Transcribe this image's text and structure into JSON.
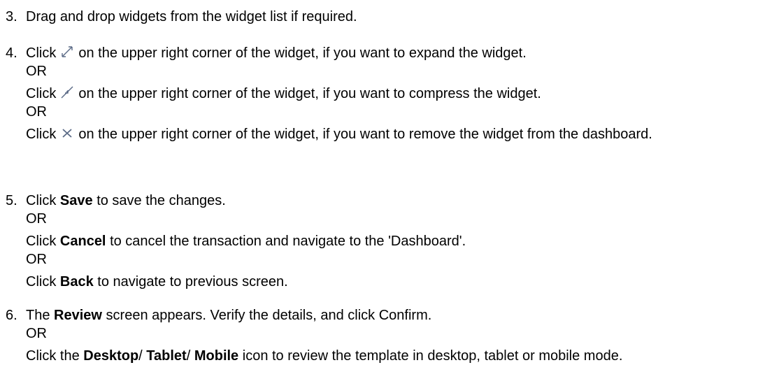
{
  "steps": [
    {
      "number": "3.",
      "text": "Drag and drop widgets from the widget list if required."
    },
    {
      "number": "4.",
      "expand": {
        "pre": "Click",
        "icon": "expand-icon",
        "post": "on the upper right corner of the widget, if you want to expand the widget."
      },
      "or1": "OR",
      "compress": {
        "pre": "Click",
        "icon": "compress-icon",
        "post": "on the upper right corner of the widget, if you want to compress the widget."
      },
      "or2": "OR",
      "remove": {
        "pre": "Click",
        "icon": "close-icon",
        "post": "on the upper right corner of the widget, if you want to remove the widget from the dashboard."
      }
    },
    {
      "number": "5.",
      "save": {
        "pre": "Click",
        "bold": "Save",
        "post": "to save the changes."
      },
      "or1": "OR",
      "cancel": {
        "pre": "Click",
        "bold": "Cancel",
        "post": "to cancel the transaction and navigate to the 'Dashboard'."
      },
      "or2": "OR",
      "back": {
        "pre": "Click",
        "bold": "Back",
        "post": "to navigate to previous screen."
      }
    },
    {
      "number": "6.",
      "review": {
        "pre": "The",
        "bold": "Review",
        "post": "screen appears. Verify the details, and click Confirm."
      },
      "or1": "OR",
      "devices": {
        "pre": "Click the",
        "desktop": "Desktop",
        "sep1": "/",
        "tablet": "Tablet",
        "sep2": "/",
        "mobile": "Mobile",
        "post": "icon to review the template in desktop, tablet or mobile mode."
      }
    }
  ],
  "icon_color": "#5a6a86"
}
